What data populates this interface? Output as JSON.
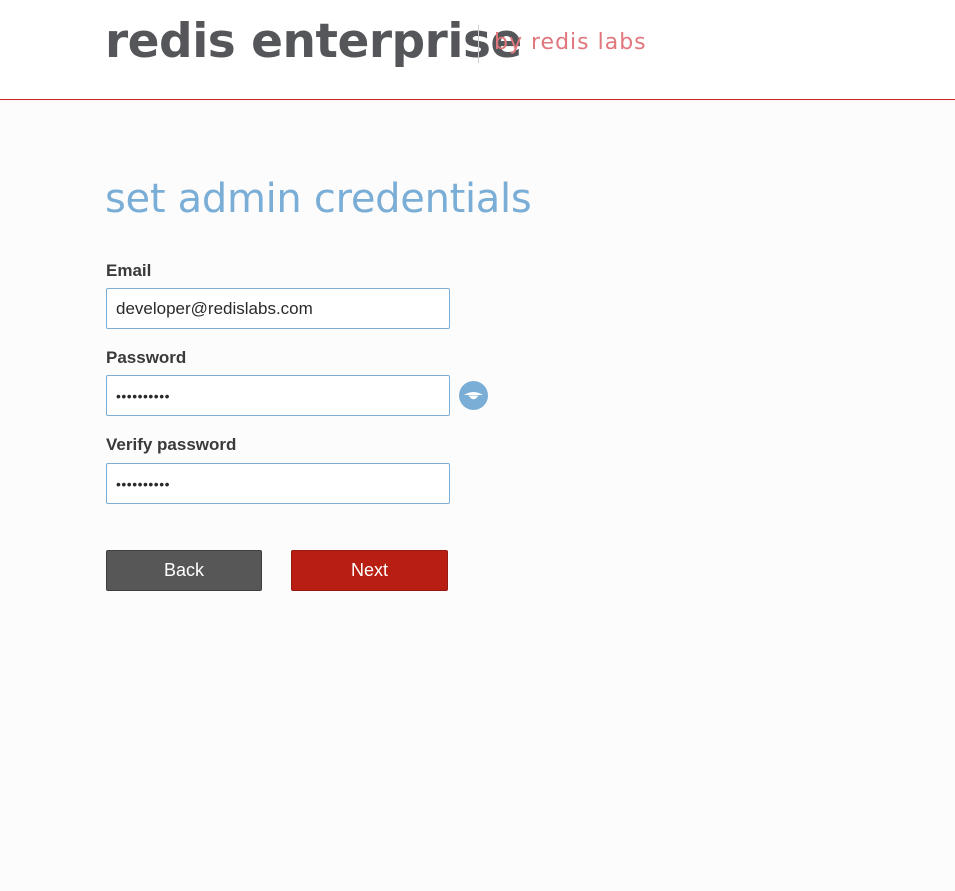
{
  "header": {
    "logo_main": "redis enterprise",
    "logo_sub": "by redis labs"
  },
  "main": {
    "title": "set admin credentials",
    "email": {
      "label": "Email",
      "value": "developer@redislabs.com"
    },
    "password": {
      "label": "Password",
      "value": "••••••••••"
    },
    "verify_password": {
      "label": "Verify password",
      "value": "••••••••••"
    },
    "show_password_icon": "eye-icon"
  },
  "actions": {
    "back_label": "Back",
    "next_label": "Next"
  },
  "colors": {
    "accent_blue": "#7aaed6",
    "brand_red": "#b81f12",
    "header_border": "#c8242c",
    "back_button": "#575757"
  }
}
